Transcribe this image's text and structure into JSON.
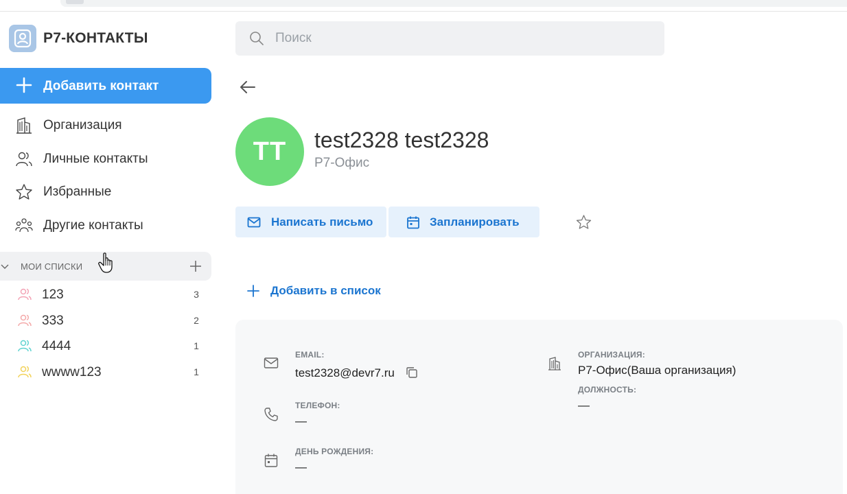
{
  "sidebar": {
    "brand": "Р7-КОНТАКТЫ",
    "add_contact": "Добавить контакт",
    "nav": [
      {
        "label": "Организация",
        "icon": "building-icon"
      },
      {
        "label": "Личные контакты",
        "icon": "users-icon"
      },
      {
        "label": "Избранные",
        "icon": "star-icon"
      },
      {
        "label": "Другие контакты",
        "icon": "group-icon"
      }
    ],
    "lists_title": "МОИ СПИСКИ",
    "lists": [
      {
        "label": "123",
        "count": "3",
        "color": "#f3a3b5"
      },
      {
        "label": "333",
        "count": "2",
        "color": "#f4a9a9"
      },
      {
        "label": "4444",
        "count": "1",
        "color": "#5fd3d0"
      },
      {
        "label": "wwww123",
        "count": "1",
        "color": "#f2d25a"
      }
    ]
  },
  "search": {
    "placeholder": "Поиск"
  },
  "contact": {
    "initials": "TT",
    "name": "test2328 test2328",
    "org": "Р7-Офис",
    "avatar_color": "#6ddc7a"
  },
  "actions": {
    "mail": "Написать письмо",
    "plan": "Запланировать",
    "add_to_list": "Добавить в список"
  },
  "details": {
    "email_label": "EMAIL:",
    "email_value": "test2328@devr7.ru",
    "phone_label": "ТЕЛЕФОН:",
    "phone_value": "—",
    "birthday_label": "ДЕНЬ РОЖДЕНИЯ:",
    "birthday_value": "—",
    "org_label": "ОРГАНИЗАЦИЯ:",
    "org_value": "Р7-Офис(Ваша организация)",
    "position_label": "ДОЛЖНОСТЬ:",
    "position_value": "—"
  },
  "colors": {
    "accent": "#3b99f0",
    "link": "#1b75d0",
    "button_bg": "#e6f1fc"
  }
}
